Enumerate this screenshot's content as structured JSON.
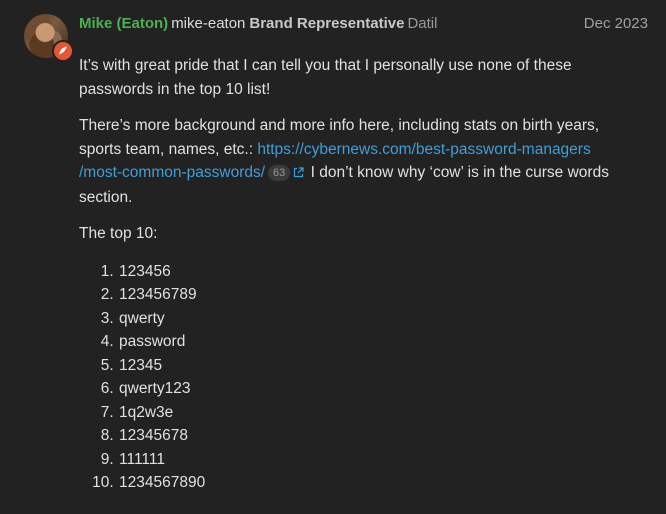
{
  "post": {
    "author": {
      "full_name": "Mike (Eaton)",
      "username": "mike-eaton",
      "title": "Brand Representative",
      "group": "Datil",
      "avatar_icon": "user-avatar-icon",
      "flair_icon": "chili-pepper-icon",
      "flair_color": "#e45735"
    },
    "date": "Dec 2023",
    "paragraphs": {
      "p1": "It’s with great pride that I can tell you that I personally use none of these passwords in the top 10 list!",
      "p2_before": "There’s more background and more info here, including stats on birth years, sports team, names, etc.: ",
      "p2_link_line1": "https://cybernews.com/best-password-managers",
      "p2_link_line2": "/most-common-passwords/",
      "p2_click_count": "63",
      "p2_after": " I don’t know why ‘cow’ is in the curse words section.",
      "p3": "The top 10:"
    },
    "top10": [
      "123456",
      "123456789",
      "qwerty",
      "password",
      "12345",
      "qwerty123",
      "1q2w3e",
      "12345678",
      "111111",
      "1234567890"
    ]
  },
  "colors": {
    "background": "#222222",
    "name": "#4cb050",
    "link": "#3f9fd8",
    "text": "#e0e0e0",
    "muted": "#a0a0a0"
  }
}
